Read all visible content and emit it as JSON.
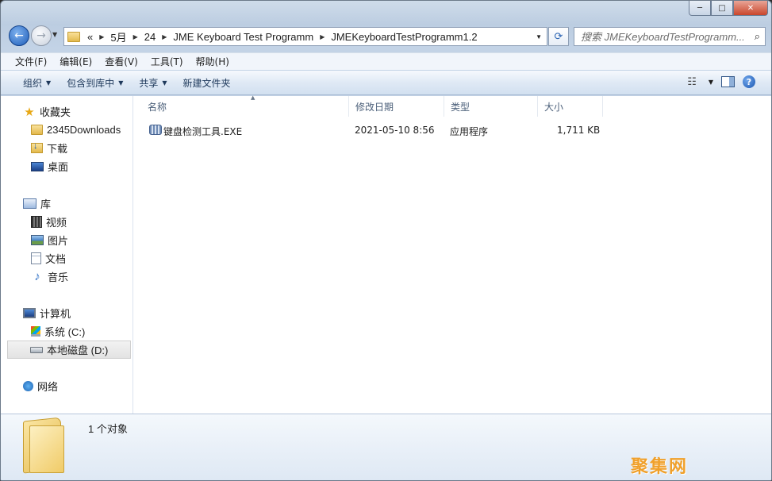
{
  "titlebar": {
    "min_label": "─",
    "max_label": "□",
    "close_label": "✕"
  },
  "nav": {
    "back_label": "←",
    "forward_label": "→",
    "breadcrumb": [
      {
        "label": "«"
      },
      {
        "label": "5月"
      },
      {
        "label": "24"
      },
      {
        "label": "JME Keyboard Test Programm"
      },
      {
        "label": "JMEKeyboardTestProgramm1.2"
      }
    ],
    "search_placeholder": "搜索 JMEKeyboardTestProgramm..."
  },
  "menu": [
    "文件(F)",
    "编辑(E)",
    "查看(V)",
    "工具(T)",
    "帮助(H)"
  ],
  "toolbar": {
    "organize": "组织",
    "include_in_library": "包含到库中",
    "share": "共享",
    "new_folder": "新建文件夹"
  },
  "sidebar": {
    "favorites": {
      "label": "收藏夹",
      "items": [
        "2345Downloads",
        "下载",
        "桌面"
      ]
    },
    "libraries": {
      "label": "库",
      "items": [
        "视频",
        "图片",
        "文档",
        "音乐"
      ]
    },
    "computer": {
      "label": "计算机",
      "items": [
        "系统 (C:)",
        "本地磁盘 (D:)"
      ]
    },
    "network": {
      "label": "网络"
    }
  },
  "columns": {
    "name": "名称",
    "modified": "修改日期",
    "type": "类型",
    "size": "大小"
  },
  "files": [
    {
      "name": "键盘检测工具.EXE",
      "modified": "2021-05-10 8:56",
      "type": "应用程序",
      "size": "1,711 KB"
    }
  ],
  "details": {
    "count_text": "1 个对象"
  },
  "watermark": "聚集网"
}
